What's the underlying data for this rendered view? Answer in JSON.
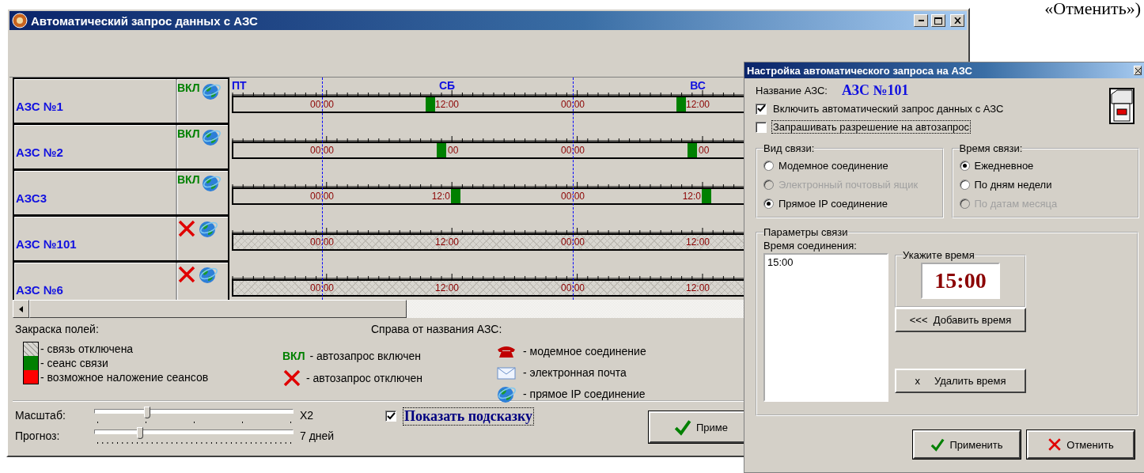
{
  "corner_note": "«Отменить»)",
  "main_window": {
    "title": "Автоматический запрос данных с АЗС",
    "days": [
      "ПТ",
      "СБ",
      "ВС"
    ],
    "stations": [
      {
        "name": "АЗС №1",
        "auto": {
          "kind": "on",
          "label": "ВКЛ"
        },
        "link": {
          "kind": "ip"
        },
        "link_off": false,
        "labels": [
          {
            "text": "00:00",
            "kind": "plain"
          },
          {
            "text": "12:00",
            "kind": "before"
          },
          {
            "text": "00:00",
            "kind": "plain"
          },
          {
            "text": "12:00",
            "kind": "before"
          }
        ]
      },
      {
        "name": "АЗС №2",
        "auto": {
          "kind": "on",
          "label": "ВКЛ"
        },
        "link": {
          "kind": "ip"
        },
        "link_off": false,
        "labels": [
          {
            "text": "00:00",
            "kind": "plain"
          },
          {
            "text": "00",
            "kind": "over"
          },
          {
            "text": "00:00",
            "kind": "plain"
          },
          {
            "text": "00",
            "kind": "over"
          }
        ]
      },
      {
        "name": "АЗС3",
        "auto": {
          "kind": "on",
          "label": "ВКЛ"
        },
        "link": {
          "kind": "ip"
        },
        "link_off": false,
        "labels": [
          {
            "text": "00:00",
            "kind": "plain"
          },
          {
            "text": "12:0",
            "kind": "after"
          },
          {
            "text": "00:00",
            "kind": "plain"
          },
          {
            "text": "12:0",
            "kind": "after"
          }
        ]
      },
      {
        "name": "АЗС №101",
        "auto": {
          "kind": "off"
        },
        "link": {
          "kind": "ip"
        },
        "link_off": true,
        "labels": [
          {
            "text": "00:00",
            "kind": "plain"
          },
          {
            "text": "12:00",
            "kind": "plain"
          },
          {
            "text": "00:00",
            "kind": "plain"
          },
          {
            "text": "12:00",
            "kind": "plain"
          }
        ]
      },
      {
        "name": "АЗС №6",
        "auto": {
          "kind": "off"
        },
        "link": {
          "kind": "ip"
        },
        "link_off": true,
        "labels": [
          {
            "text": "00:00",
            "kind": "plain"
          },
          {
            "text": "12:00",
            "kind": "plain"
          },
          {
            "text": "00:00",
            "kind": "plain"
          },
          {
            "text": "12:00",
            "kind": "plain"
          }
        ]
      }
    ],
    "legend": {
      "fill_title": "Закраска полей:",
      "fills": [
        {
          "kind": "off",
          "text": "- связь отключена"
        },
        {
          "kind": "session",
          "text": "- сеанс связи"
        },
        {
          "kind": "overlap",
          "text": "- возможное наложение сеансов"
        }
      ],
      "marks_title": "Справа от названия АЗС:",
      "autos": [
        {
          "kind": "on",
          "label": "ВКЛ",
          "text": "- автозапрос включен"
        },
        {
          "kind": "off",
          "text": "- автозапрос отключен"
        }
      ],
      "links": [
        {
          "kind": "modem",
          "text": "- модемное соединение"
        },
        {
          "kind": "mail",
          "text": "- электронная почта"
        },
        {
          "kind": "ip",
          "text": "- прямое IP соединение"
        }
      ]
    },
    "sliders": [
      {
        "label": "Масштаб:",
        "level": 0.26,
        "reading": "X2",
        "kind": "sparse"
      },
      {
        "label": "Прогноз:",
        "level": 0.22,
        "reading": "7 дней",
        "kind": "dense"
      }
    ],
    "hint": {
      "label": "Показать подсказку",
      "checked": true,
      "focused": true
    },
    "apply_button": "Приме"
  },
  "dialog": {
    "title": "Настройка автоматического запроса на АЗС",
    "name_label": "Название АЗС:",
    "name_value": "АЗС №101",
    "checkboxes": [
      {
        "label": "Включить автоматический запрос данных с АЗС",
        "checked": true,
        "focused": false
      },
      {
        "label": "Запрашивать разрешение на автозапрос",
        "checked": false,
        "focused": true
      }
    ],
    "groups": [
      {
        "title": "Вид связи:",
        "options": [
          {
            "label": "Модемное соединение",
            "selected": false,
            "disabled": false
          },
          {
            "label": "Электронный почтовый ящик",
            "selected": false,
            "disabled": true
          },
          {
            "label": "Прямое IP соединение",
            "selected": true,
            "disabled": false
          }
        ]
      },
      {
        "title": "Время связи:",
        "options": [
          {
            "label": "Ежедневное",
            "selected": true,
            "disabled": false
          },
          {
            "label": "По дням недели",
            "selected": false,
            "disabled": false
          },
          {
            "label": "По датам месяца",
            "selected": false,
            "disabled": true
          }
        ]
      }
    ],
    "params": {
      "title": "Параметры связи",
      "list_label": "Время соединения:",
      "times": [
        "15:00"
      ],
      "time_group": "Укажите время",
      "time_value": "15:00",
      "add_button": "<<<  Добавить время",
      "delete_mark": "x",
      "delete_button": "Удалить время"
    },
    "buttons": [
      {
        "kind": "apply",
        "label": "Применить"
      },
      {
        "kind": "cancel",
        "label": "Отменить"
      }
    ]
  }
}
